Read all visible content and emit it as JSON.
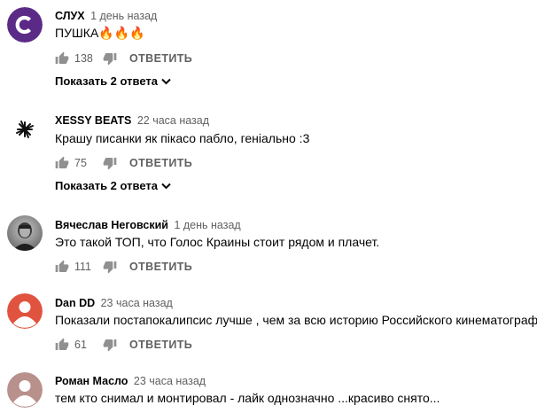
{
  "comments": [
    {
      "author": "СЛУХ",
      "time": "1 день назад",
      "text": "ПУШКА🔥🔥🔥",
      "likes": "138",
      "reply_label": "ОТВЕТИТЬ",
      "replies_label": "Показать 2 ответа",
      "avatar": "letter-c-avatar",
      "avatar_color": "#5b2a86"
    },
    {
      "author": "XESSY BEATS",
      "time": "22 часа назад",
      "text": "Крашу писанки як пікасо пабло, геніально :3",
      "likes": "75",
      "reply_label": "ОТВЕТИТЬ",
      "replies_label": "Показать 2 ответа",
      "avatar": "starburst-avatar"
    },
    {
      "author": "Вячеслав Неговский",
      "time": "1 день назад",
      "text": "Это такой ТОП, что Голос Краины стоит рядом и плачет.",
      "likes": "111",
      "reply_label": "ОТВЕТИТЬ",
      "avatar": "photo-avatar"
    },
    {
      "author": "Dan DD",
      "time": "23 часа назад",
      "text": "Показали постапокалипсис лучше , чем за всю историю Российского кинематографа",
      "likes": "61",
      "reply_label": "ОТВЕТИТЬ",
      "avatar": "default-user-avatar",
      "avatar_color": "#e0533e"
    },
    {
      "author": "Роман Масло",
      "time": "23 часа назад",
      "text": "тем кто снимал и монтировал - лайк однозначно ...красиво снято...",
      "avatar": "default-user-avatar",
      "avatar_color": "#b8908c"
    }
  ]
}
